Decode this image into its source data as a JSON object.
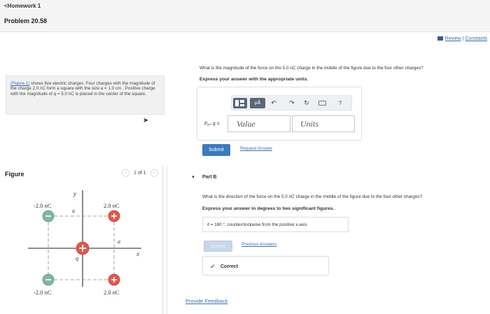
{
  "header": {
    "back_label": "<Homework 1",
    "problem_title": "Problem 20.58"
  },
  "top_links": {
    "review": "Review",
    "separator": "|",
    "constants": "Constants"
  },
  "intro": {
    "figure_link": "(Figure 1)",
    "text": " shows five electric charges. Four charges with the magnitude of the charge 2.0 nC form a square with the size a = 1.0 cm . Positive charge with the magnitude of q = 5.0 nC is placed in the center of the square."
  },
  "figure": {
    "label": "Figure",
    "pager": "1 of 1",
    "prev_icon": "chevron-left-icon",
    "next_icon": "chevron-right-icon",
    "charges": {
      "top_left": "-2.0 nC",
      "top_right": "2.0 nC",
      "bottom_left": "-2.0 nC",
      "bottom_right": "2.0 nC"
    },
    "axis_x": "x",
    "axis_y": "y",
    "a_label": "a",
    "q_label": "q",
    "colors": {
      "negative": "#7fb8a0",
      "positive": "#e2574c",
      "axis": "#6b6b6b"
    }
  },
  "part_a": {
    "question": "What is the magnitude of the force on the 5.0 nC charge in the middle of the figure due to the four other charges?",
    "express": "Express your answer with the appropriate units.",
    "toolbar": {
      "mu_label": "μÅ",
      "undo_icon": "undo-icon",
      "redo_icon": "redo-icon",
      "reset_icon": "reset-icon",
      "keyboard_icon": "keyboard-icon",
      "help_label": "?"
    },
    "f_label": "Fₒₙ q =",
    "value_placeholder": "Value",
    "units_placeholder": "Units",
    "submit_label": "Submit",
    "request_answer_label": "Request Answer"
  },
  "part_b": {
    "label": "Part B",
    "question": "What is the direction of the force on the 5.0 nC charge in the middle of the figure due to the four other charges?",
    "express": "Express your answer in degrees to two significant figures.",
    "answer_theta": "θ",
    "answer_value": "= 180",
    "answer_suffix": "°, counterclockwise from the positive x-axis",
    "submit_label": "Submit",
    "previous_answers_label": "Previous Answers",
    "status": "Correct"
  },
  "footer": {
    "feedback_label": "Provide Feedback"
  },
  "colors": {
    "accent": "#3a7bbf",
    "link": "#3b6fb6",
    "success": "#4a9a3b"
  }
}
